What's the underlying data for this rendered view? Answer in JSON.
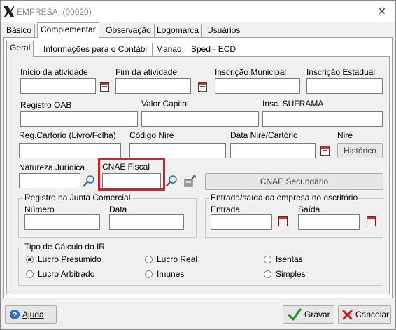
{
  "window": {
    "title": "EMPRESA: (00020)",
    "close_symbol": "✕"
  },
  "tabs_main": [
    "Básico",
    "Complementar",
    "Observação",
    "Logomarca",
    "Usuários"
  ],
  "tabs_sub": [
    "Geral",
    "Informações para o Contábil",
    "Manad",
    "Sped - ECD"
  ],
  "fields": {
    "inicio_atividade": "Início da atividade",
    "fim_atividade": "Fim da atividade",
    "inscricao_municipal": "Inscrição Municipal",
    "inscricao_estadual": "Inscrição Estadual",
    "registro_oab": "Registro OAB",
    "valor_capital": "Valor Capital",
    "insc_suframa": "Insc. SUFRAMA",
    "reg_cartorio": "Reg.Cartório (Livro/Folha)",
    "codigo_nire": "Código Nire",
    "data_nire": "Data Nire/Cartório",
    "nire": "Nire",
    "natureza_juridica": "Natureza Jurídica",
    "cnae_fiscal": "CNAE Fiscal"
  },
  "buttons": {
    "historico": "Histórico",
    "cnae_secundario": "CNAE Secundário",
    "ajuda": "Ajuda",
    "gravar": "Gravar",
    "cancelar": "Cancelar"
  },
  "group_junta": {
    "title": "Registro na Junta Comercial",
    "numero": "Número",
    "data": "Data"
  },
  "group_entrada": {
    "title": "Entrada/saída da empresa no escritório",
    "entrada": "Entrada",
    "saida": "Saída"
  },
  "group_ir": {
    "title": "Tipo de Cálculo do IR",
    "options": [
      "Lucro Presumido",
      "Lucro Real",
      "Isentas",
      "Lucro Arbitrado",
      "Imunes",
      "Simples"
    ],
    "selected": "Lucro Presumido"
  },
  "colors": {
    "highlight": "#e11b22",
    "check": "#1a9b2a",
    "cancel": "#cc1f1f"
  }
}
